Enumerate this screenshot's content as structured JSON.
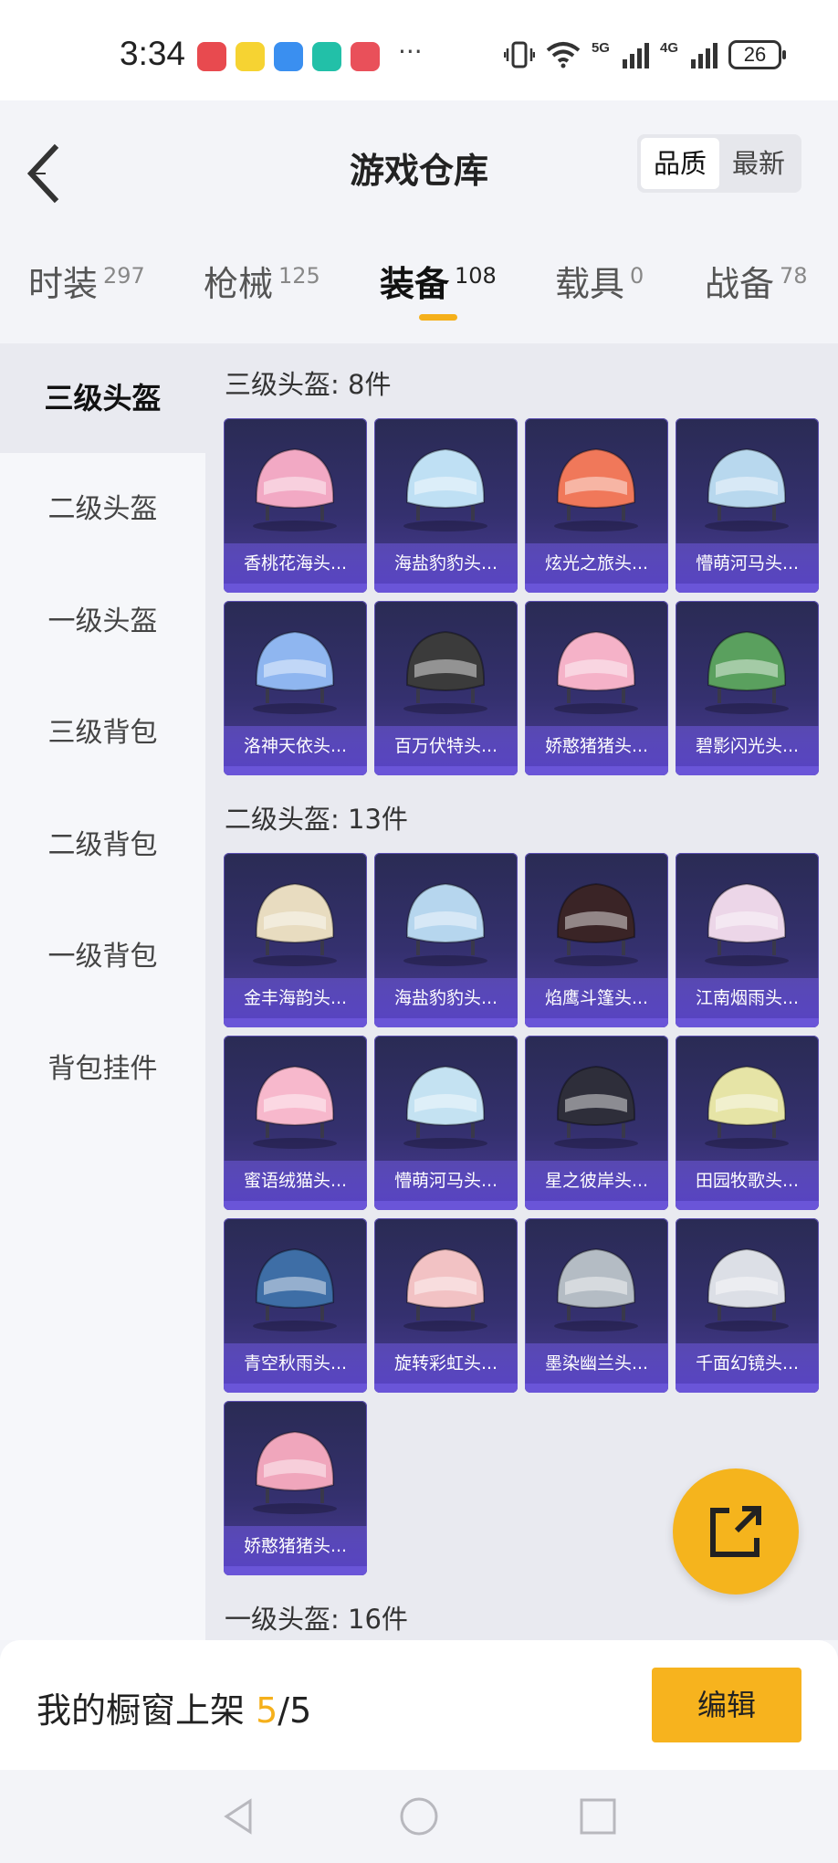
{
  "status": {
    "time": "3:34",
    "more": "···",
    "network1": "5G",
    "network2": "4G",
    "battery": "26",
    "apps": [
      "#e84a4f",
      "#f6d332",
      "#3a8ff0",
      "#22c0a8",
      "#e9505a"
    ]
  },
  "header": {
    "title": "游戏仓库",
    "sort": {
      "quality": "品质",
      "newest": "最新"
    }
  },
  "tabs": [
    {
      "label": "时装",
      "count": "297"
    },
    {
      "label": "枪械",
      "count": "125"
    },
    {
      "label": "装备",
      "count": "108"
    },
    {
      "label": "载具",
      "count": "0"
    },
    {
      "label": "战备",
      "count": "78"
    }
  ],
  "sidebar": {
    "items": [
      "三级头盔",
      "二级头盔",
      "一级头盔",
      "三级背包",
      "二级背包",
      "一级背包",
      "背包挂件"
    ]
  },
  "sections": [
    {
      "title": "三级头盔: 8件",
      "items": [
        {
          "name": "香桃花海头...",
          "color": "#f2a9c4"
        },
        {
          "name": "海盐豹豹头...",
          "color": "#bfe0f4"
        },
        {
          "name": "炫光之旅头...",
          "color": "#f0785a"
        },
        {
          "name": "懵萌河马头...",
          "color": "#b8d8ee"
        },
        {
          "name": "洛神天依头...",
          "color": "#8fb6f0"
        },
        {
          "name": "百万伏特头...",
          "color": "#3b3b3b"
        },
        {
          "name": "娇憨猪猪头...",
          "color": "#f5b2c8"
        },
        {
          "name": "碧影闪光头...",
          "color": "#5aa05e"
        }
      ]
    },
    {
      "title": "二级头盔: 13件",
      "items": [
        {
          "name": "金丰海韵头...",
          "color": "#e8dcc0"
        },
        {
          "name": "海盐豹豹头...",
          "color": "#b6d6ee"
        },
        {
          "name": "焰鹰斗篷头...",
          "color": "#3a2426"
        },
        {
          "name": "江南烟雨头...",
          "color": "#ecd6e8"
        },
        {
          "name": "蜜语绒猫头...",
          "color": "#f7b8cc"
        },
        {
          "name": "懵萌河马头...",
          "color": "#c4e2f2"
        },
        {
          "name": "星之彼岸头...",
          "color": "#2e2e3a"
        },
        {
          "name": "田园牧歌头...",
          "color": "#e6e4a6"
        },
        {
          "name": "青空秋雨头...",
          "color": "#3e6ea6"
        },
        {
          "name": "旋转彩虹头...",
          "color": "#f2c2c4"
        },
        {
          "name": "墨染幽兰头...",
          "color": "#b4bcc4"
        },
        {
          "name": "千面幻镜头...",
          "color": "#dcdfe6"
        },
        {
          "name": "娇憨猪猪头...",
          "color": "#f0a6bc"
        }
      ]
    },
    {
      "title": "一级头盔: 16件",
      "items": []
    }
  ],
  "bottom": {
    "shelf_label": "我的橱窗上架",
    "shelf_count": "5",
    "shelf_total": "/5",
    "edit": "编辑"
  },
  "colors": {
    "accent": "#f5b01b",
    "card_bg": "#34306e"
  }
}
